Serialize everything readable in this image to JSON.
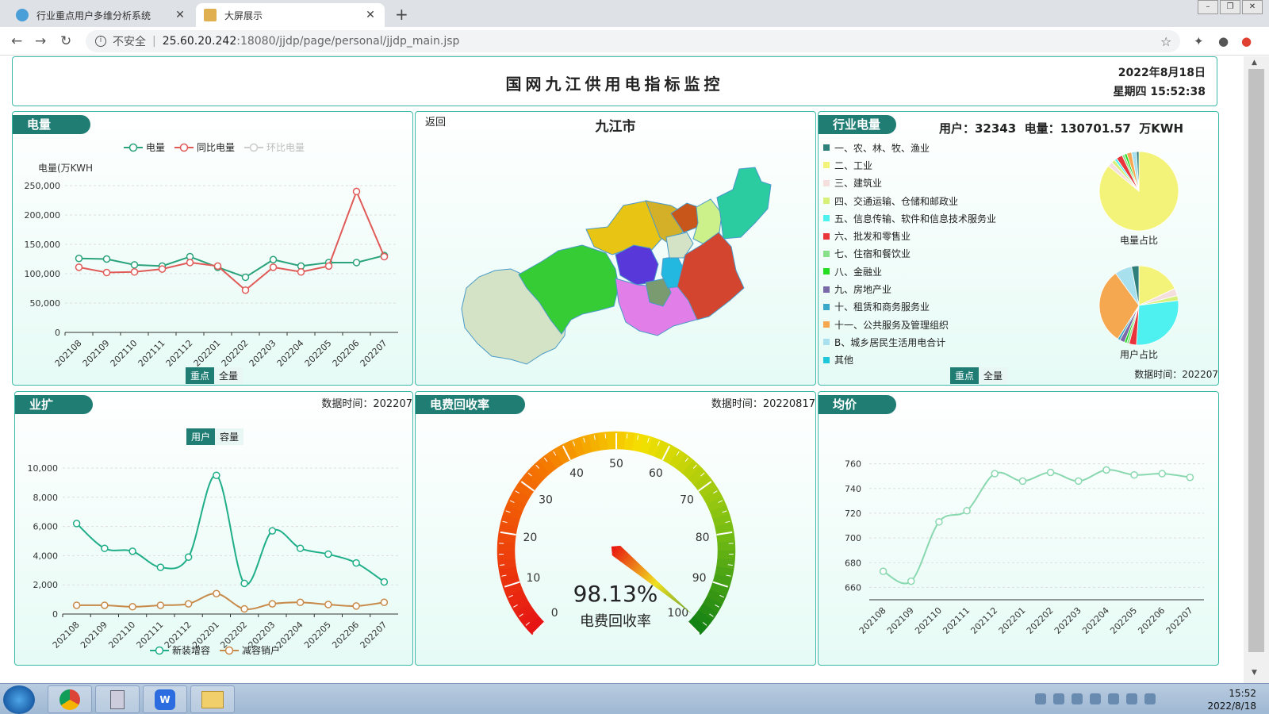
{
  "browser": {
    "tabs": [
      {
        "title": "行业重点用户多维分析系统",
        "active": false
      },
      {
        "title": "大屏展示",
        "active": true
      }
    ],
    "security_label": "不安全",
    "url_host": "25.60.20.242",
    "url_rest": ":18080/jjdp/page/personal/jjdp_main.jsp"
  },
  "header": {
    "title": "国网九江供用电指标监控",
    "date": "2022年8月18日",
    "weekday_time": "星期四 15:52:38"
  },
  "power_panel": {
    "title": "电量",
    "toggle": [
      "重点",
      "全量"
    ],
    "chart_data": {
      "type": "line",
      "title": "",
      "ylabel": "电量(万KWH",
      "ylim": [
        0,
        250000
      ],
      "yticks": [
        "250,000",
        "200,000",
        "150,000",
        "100,000",
        "50,000",
        "0"
      ],
      "categories": [
        "202108",
        "202109",
        "202110",
        "202111",
        "202112",
        "202201",
        "202202",
        "202203",
        "202204",
        "202205",
        "202206",
        "202207"
      ],
      "series": [
        {
          "name": "电量",
          "color": "#2aa37a",
          "values": [
            126000,
            125000,
            115000,
            113000,
            129000,
            111000,
            94000,
            124000,
            113000,
            119000,
            119000,
            131000
          ]
        },
        {
          "name": "同比电量",
          "color": "#e05a58",
          "values": [
            111000,
            102000,
            103000,
            108000,
            119000,
            113000,
            72000,
            111000,
            103000,
            113000,
            240000,
            129000
          ]
        },
        {
          "name": "环比电量",
          "color": "#cccccc",
          "values": [],
          "inactive": true
        }
      ]
    }
  },
  "map_panel": {
    "back_label": "返回",
    "region_title": "九江市"
  },
  "industry_panel": {
    "title": "行业电量",
    "summary": "用户：32343  电量：130701.57  万KWH",
    "data_time": "数据时间：202207",
    "toggle": [
      "重点",
      "全量"
    ],
    "legend": [
      {
        "label": "一、农、林、牧、渔业",
        "color": "#2f7f7a"
      },
      {
        "label": "二、工业",
        "color": "#f3f37a"
      },
      {
        "label": "三、建筑业",
        "color": "#f5dede"
      },
      {
        "label": "四、交通运输、仓储和邮政业",
        "color": "#d6f07a"
      },
      {
        "label": "五、信息传输、软件和信息技术服务业",
        "color": "#4ef0f0"
      },
      {
        "label": "六、批发和零售业",
        "color": "#e8343a"
      },
      {
        "label": "七、住宿和餐饮业",
        "color": "#8ae08a"
      },
      {
        "label": "八、金融业",
        "color": "#22dd22"
      },
      {
        "label": "九、房地产业",
        "color": "#7a6aa8"
      },
      {
        "label": "十、租赁和商务服务业",
        "color": "#3aa8c8"
      },
      {
        "label": "十一、公共服务及管理组织",
        "color": "#f5a850"
      },
      {
        "label": "B、城乡居民生活用电合计",
        "color": "#a8e0ee"
      },
      {
        "label": "其他",
        "color": "#1ec8d8"
      }
    ],
    "chart_data": [
      {
        "type": "pie",
        "title": "电量占比",
        "slices": [
          {
            "name": "二、工业",
            "value": 86,
            "color": "#f3f37a"
          },
          {
            "name": "三、建筑业",
            "value": 2,
            "color": "#f5dede"
          },
          {
            "name": "四、交通运输、仓储和邮政业",
            "value": 1.5,
            "color": "#d6f07a"
          },
          {
            "name": "五、信息传输、软件和信息技术服务业",
            "value": 1,
            "color": "#4ef0f0"
          },
          {
            "name": "六、批发和零售业",
            "value": 2.5,
            "color": "#e8343a"
          },
          {
            "name": "七、住宿和餐饮业",
            "value": 1,
            "color": "#8ae08a"
          },
          {
            "name": "八、金融业",
            "value": 1,
            "color": "#22dd22"
          },
          {
            "name": "十一、公共服务及管理组织",
            "value": 2,
            "color": "#f5a850"
          },
          {
            "name": "B、城乡居民生活用电合计",
            "value": 2,
            "color": "#a8e0ee"
          },
          {
            "name": "一、农、林、牧、渔业",
            "value": 1,
            "color": "#2f7f7a"
          }
        ]
      },
      {
        "type": "pie",
        "title": "用户占比",
        "slices": [
          {
            "name": "二、工业",
            "value": 18,
            "color": "#f3f37a"
          },
          {
            "name": "三、建筑业",
            "value": 3,
            "color": "#f5dede"
          },
          {
            "name": "四、交通运输、仓储和邮政业",
            "value": 2,
            "color": "#d6f07a"
          },
          {
            "name": "五、信息传输、软件和信息技术服务业",
            "value": 28,
            "color": "#4ef0f0"
          },
          {
            "name": "六、批发和零售业",
            "value": 3,
            "color": "#e8343a"
          },
          {
            "name": "七、住宿和餐饮业",
            "value": 1,
            "color": "#8ae08a"
          },
          {
            "name": "八、金融业",
            "value": 1,
            "color": "#22dd22"
          },
          {
            "name": "九、房地产业",
            "value": 2,
            "color": "#7a6aa8"
          },
          {
            "name": "十、租赁和商务服务业",
            "value": 1,
            "color": "#3aa8c8"
          },
          {
            "name": "十一、公共服务及管理组织",
            "value": 31,
            "color": "#f5a850"
          },
          {
            "name": "B、城乡居民生活用电合计",
            "value": 7,
            "color": "#a8e0ee"
          },
          {
            "name": "一、农、林、牧、渔业",
            "value": 3,
            "color": "#2f7f7a"
          }
        ]
      }
    ]
  },
  "yekuo_panel": {
    "title": "业扩",
    "data_time": "数据时间：202207",
    "toggle": [
      "用户",
      "容量"
    ],
    "chart_data": {
      "type": "line",
      "ylim": [
        0,
        10000
      ],
      "yticks": [
        "10,000",
        "8,000",
        "6,000",
        "4,000",
        "2,000",
        "0"
      ],
      "categories": [
        "202108",
        "202109",
        "202110",
        "202111",
        "202112",
        "202201",
        "202202",
        "202203",
        "202204",
        "202205",
        "202206",
        "202207"
      ],
      "series": [
        {
          "name": "新装增容",
          "color": "#1fae88",
          "values": [
            6200,
            4500,
            4300,
            3200,
            3900,
            9500,
            2100,
            5700,
            4500,
            4100,
            3500,
            2200
          ]
        },
        {
          "name": "减容销户",
          "color": "#c88a4a",
          "values": [
            600,
            600,
            500,
            600,
            700,
            1400,
            350,
            700,
            800,
            650,
            550,
            800
          ]
        }
      ]
    }
  },
  "recovery_panel": {
    "title": "电费回收率",
    "data_time": "数据时间：20220817",
    "gauge": {
      "value": 98.13,
      "value_label": "98.13%",
      "caption": "电费回收率",
      "min": 0,
      "max": 100,
      "ticks": [
        "0",
        "10",
        "20",
        "30",
        "40",
        "50",
        "60",
        "70",
        "80",
        "90",
        "100"
      ]
    }
  },
  "price_panel": {
    "title": "均价",
    "chart_data": {
      "type": "line",
      "ylim": [
        650,
        770
      ],
      "yticks": [
        "760",
        "740",
        "720",
        "700",
        "680",
        "660"
      ],
      "categories": [
        "202108",
        "202109",
        "202110",
        "202111",
        "202112",
        "202201",
        "202202",
        "202203",
        "202204",
        "202205",
        "202206",
        "202207"
      ],
      "series": [
        {
          "color": "#8ad8b0",
          "values": [
            673,
            665,
            713,
            722,
            752,
            746,
            753,
            746,
            755,
            751,
            752,
            749
          ]
        }
      ]
    }
  },
  "taskbar": {
    "time": "15:52",
    "date": "2022/8/18"
  }
}
